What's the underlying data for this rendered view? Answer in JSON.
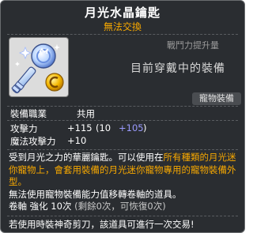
{
  "item": {
    "name": "月光水晶鑰匙",
    "trade_status": "無法交換"
  },
  "power": {
    "label": "戰鬥力提升量",
    "equip_status": "目前穿戴中的裝備"
  },
  "category_tag": "寵物裝備",
  "job": {
    "label": "裝備職業",
    "value": "共用"
  },
  "stats": [
    {
      "name": "攻擊力",
      "total": "+115",
      "base": "(10",
      "bonus": "+105",
      "close": ")"
    },
    {
      "name": "魔法攻擊力",
      "total": "+10"
    }
  ],
  "description": {
    "part1": "受到月光之力的華麗鑰匙。可以使用在",
    "highlight": "所有種類的月光迷你寵物上，會套用裝備的月光迷你寵物專用的寵物裝備外型。",
    "line2": "無法使用寵物裝備能力值移轉卷軸的道具。",
    "scroll_label": "卷軸 強化 10次",
    "scroll_detail": "(剩餘0次，可恢復0次)"
  },
  "warning": "若使用時裝神奇剪刀，該道具可進行一次交易!",
  "colors": {
    "background": "#2a2d31",
    "accent_orange": "#f7a800",
    "bonus_blue": "#9b9bff"
  },
  "icons": [
    "moonlight-crystal-key-icon",
    "gold-coin-icon"
  ]
}
